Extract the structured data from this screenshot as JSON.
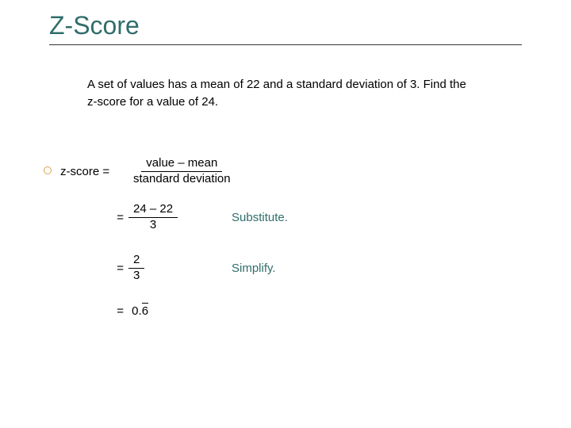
{
  "title": "Z-Score",
  "problem": {
    "line1": "A set of values has a mean of 22 and a standard deviation of 3. Find the",
    "line2": "z-score for a value of 24."
  },
  "formula": {
    "lhs": "z-score =",
    "num": "value – mean",
    "den": "standard deviation"
  },
  "steps": [
    {
      "eq": "=",
      "num": "24 – 22",
      "den": "3",
      "annot": "Substitute."
    },
    {
      "eq": "=",
      "num": "2",
      "den": "3",
      "annot": "Simplify."
    }
  ],
  "result": {
    "eq": "=",
    "prefix": "0.",
    "repeating": "6"
  }
}
